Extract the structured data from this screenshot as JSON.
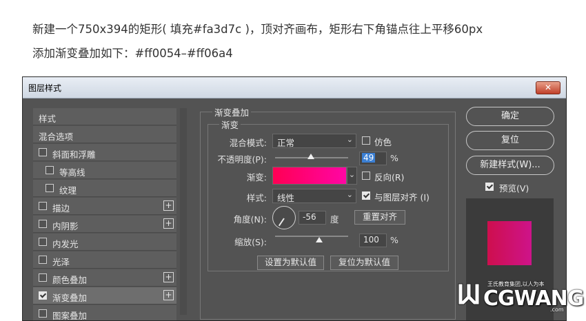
{
  "instructions": {
    "line1": "新建一个750x394的矩形( 填充#fa3d7c )，顶对齐画布，矩形右下角锚点往上平移60px",
    "line2": "添加渐变叠加如下：#ff0054–#ff06a4"
  },
  "dialog": {
    "title": "图层样式",
    "close_label": "✕",
    "styles_header": "样式",
    "blend_options": "混合选项",
    "items": [
      {
        "label": "斜面和浮雕",
        "checked": false,
        "indent": false,
        "plus": false
      },
      {
        "label": "等高线",
        "checked": false,
        "indent": true,
        "plus": false
      },
      {
        "label": "纹理",
        "checked": false,
        "indent": true,
        "plus": false
      },
      {
        "label": "描边",
        "checked": false,
        "indent": false,
        "plus": true
      },
      {
        "label": "内阴影",
        "checked": false,
        "indent": false,
        "plus": true
      },
      {
        "label": "内发光",
        "checked": false,
        "indent": false,
        "plus": false
      },
      {
        "label": "光泽",
        "checked": false,
        "indent": false,
        "plus": false
      },
      {
        "label": "颜色叠加",
        "checked": false,
        "indent": false,
        "plus": true
      },
      {
        "label": "渐变叠加",
        "checked": true,
        "indent": false,
        "plus": true
      },
      {
        "label": "图案叠加",
        "checked": false,
        "indent": false,
        "plus": false
      }
    ],
    "panel": {
      "group_title": "渐变叠加",
      "sub_title": "渐变",
      "blend_mode_label": "混合模式:",
      "blend_mode_value": "正常",
      "dither_label": "仿色",
      "opacity_label": "不透明度(P):",
      "opacity_value": "49",
      "opacity_unit": "%",
      "opacity_level": 0.49,
      "gradient_label": "渐变:",
      "gradient_from": "#ff0054",
      "gradient_to": "#ff06a4",
      "reverse_label": "反向(R)",
      "style_label": "样式:",
      "style_value": "线性",
      "align_label": "与图层对齐 (I)",
      "angle_label": "角度(N):",
      "angle_value": "-56",
      "angle_unit": "度",
      "reset_align_label": "重置对齐",
      "scale_label": "缩放(S):",
      "scale_value": "100",
      "scale_unit": "%",
      "set_default_label": "设置为默认值",
      "reset_default_label": "复位为默认值"
    },
    "buttons": {
      "ok": "确定",
      "reset": "复位",
      "new_style": "新建样式(W)...",
      "preview": "预览(V)"
    }
  },
  "watermark": {
    "brand": "CGWANG",
    "tagline": "王氏教育集团,以人为本",
    "domain": ".com"
  }
}
